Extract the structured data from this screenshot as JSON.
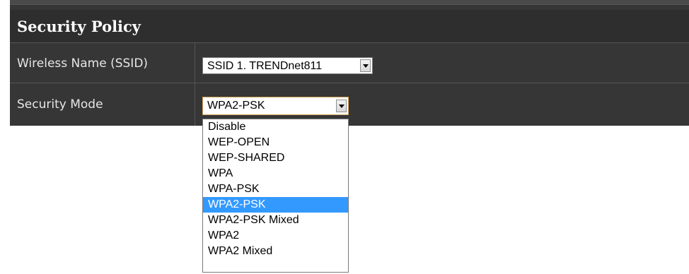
{
  "panel": {
    "title": "Security Policy"
  },
  "rows": [
    {
      "label": "Wireless Name (SSID)",
      "value": "SSID 1. TRENDnet811"
    },
    {
      "label": "Security Mode",
      "value": "WPA2-PSK"
    }
  ],
  "security_mode_dropdown": {
    "open": true,
    "selected": "WPA2-PSK",
    "options": [
      "Disable",
      "WEP-OPEN",
      "WEP-SHARED",
      "WPA",
      "WPA-PSK",
      "WPA2-PSK",
      "WPA2-PSK Mixed",
      "WPA2",
      "WPA2 Mixed"
    ]
  },
  "colors": {
    "panel_bg": "#363636",
    "header_bg": "#2e2e2e",
    "highlight": "#3399ff",
    "focus_border": "#d4a256"
  }
}
